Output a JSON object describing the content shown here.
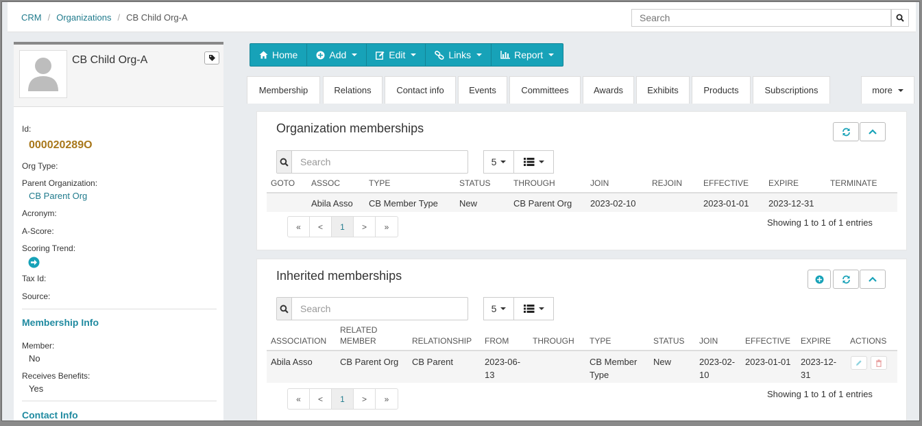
{
  "breadcrumb": {
    "items": [
      "CRM",
      "Organizations"
    ],
    "current": "CB Child Org-A"
  },
  "top_search": {
    "placeholder": "Search"
  },
  "profile": {
    "name": "CB Child Org-A",
    "fields": {
      "id_label": "Id:",
      "id_value": "000020289O",
      "org_type_label": "Org Type:",
      "parent_label": "Parent Organization:",
      "parent_value": "CB Parent Org",
      "acronym_label": "Acronym:",
      "ascore_label": "A-Score:",
      "trend_label": "Scoring Trend:",
      "tax_label": "Tax Id:",
      "source_label": "Source:"
    },
    "membership_info": {
      "title": "Membership Info",
      "member_label": "Member:",
      "member_value": "No",
      "benefits_label": "Receives Benefits:",
      "benefits_value": "Yes"
    },
    "contact_info": {
      "title": "Contact Info"
    }
  },
  "toolbar": {
    "home": "Home",
    "add": "Add",
    "edit": "Edit",
    "links": "Links",
    "report": "Report"
  },
  "tabs": [
    "Membership",
    "Relations",
    "Contact info",
    "Events",
    "Committees",
    "Awards",
    "Exhibits",
    "Products",
    "Subscriptions"
  ],
  "tabs_more": "more",
  "org_memberships": {
    "title": "Organization memberships",
    "search_placeholder": "Search",
    "page_size": "5",
    "headers": [
      "GOTO",
      "ASSOC",
      "TYPE",
      "STATUS",
      "THROUGH",
      "JOIN",
      "REJOIN",
      "EFFECTIVE",
      "EXPIRE",
      "TERMINATE"
    ],
    "row": [
      "",
      "Abila Asso",
      "CB Member Type",
      "New",
      "CB Parent Org",
      "2023-02-10",
      "",
      "2023-01-01",
      "2023-12-31",
      ""
    ],
    "pager": [
      "«",
      "<",
      "1",
      ">",
      "»"
    ],
    "showing": "Showing 1 to 1 of 1 entries"
  },
  "inherited_memberships": {
    "title": "Inherited memberships",
    "search_placeholder": "Search",
    "page_size": "5",
    "headers": [
      "ASSOCIATION",
      "RELATED MEMBER",
      "RELATIONSHIP",
      "FROM",
      "THROUGH",
      "TYPE",
      "STATUS",
      "JOIN",
      "EFFECTIVE",
      "EXPIRE",
      "ACTIONS"
    ],
    "row": [
      "Abila Asso",
      "CB Parent Org",
      "CB Parent",
      "2023-06-13",
      "",
      "CB Member Type",
      "New",
      "2023-02-10",
      "2023-01-01",
      "2023-12-31"
    ],
    "pager": [
      "«",
      "<",
      "1",
      ">",
      "»"
    ],
    "showing": "Showing 1 to 1 of 1 entries"
  },
  "colors": {
    "accent": "#17a2b8",
    "link": "#1f7a8c",
    "id": "#a8771a"
  }
}
